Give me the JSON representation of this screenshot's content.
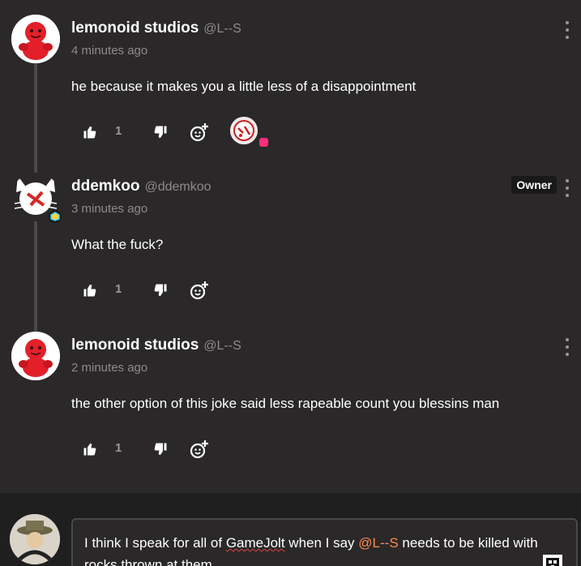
{
  "colors": {
    "background": "#2a2829",
    "text": "#ffffff",
    "muted": "#8d8a8b",
    "mention": "#ff8a4c",
    "badge_pink": "#ff2d7a"
  },
  "comments": [
    {
      "author": "lemonoid studios",
      "handle": "@L--S",
      "time": "4 minutes ago",
      "content": "he because it makes you a little less of a disappointment",
      "likes": "1",
      "has_liker_avatar": true,
      "owner_badge": ""
    },
    {
      "author": "ddemkoo",
      "handle": "@ddemkoo",
      "time": "3 minutes ago",
      "content": "What the fuck?",
      "likes": "1",
      "has_liker_avatar": false,
      "owner_badge": "Owner"
    },
    {
      "author": "lemonoid studios",
      "handle": "@L--S",
      "time": "2 minutes ago",
      "content": "the other option of this joke said less rapeable count you blessins man",
      "likes": "1",
      "has_liker_avatar": false,
      "owner_badge": ""
    }
  ],
  "editor": {
    "text_before": "I think I speak for all of ",
    "misspelled": "GameJolt",
    "text_middle": " when I say ",
    "mention": "@L--S",
    "text_after": " needs to be killed with rocks thrown at them"
  },
  "icons": {
    "like": "thumbs-up-icon",
    "dislike": "thumbs-down-icon",
    "react": "add-reaction-icon",
    "more": "more-options-icon"
  }
}
